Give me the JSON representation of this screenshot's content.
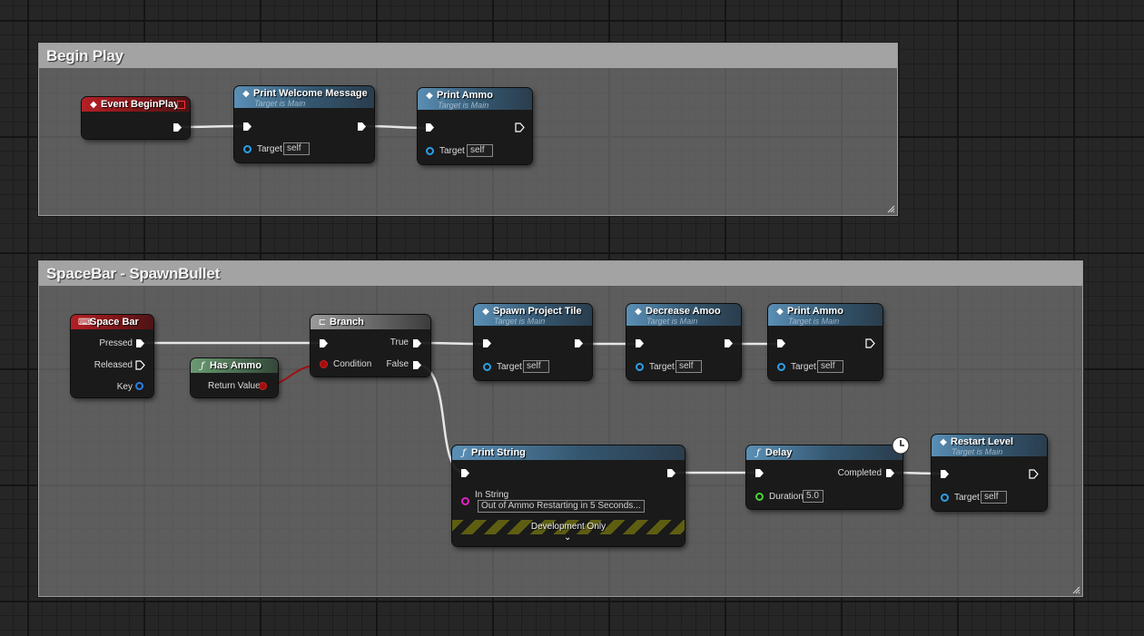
{
  "comments": {
    "begin_play": "Begin Play",
    "spacebar": "SpaceBar - SpawnBullet"
  },
  "nodes": {
    "event_begin_play": {
      "title": "Event BeginPlay"
    },
    "print_welcome": {
      "title": "Print Welcome Message",
      "subtitle": "Target is Main",
      "target_label": "Target",
      "target_value": "self"
    },
    "print_ammo_1": {
      "title": "Print Ammo",
      "subtitle": "Target is Main",
      "target_label": "Target",
      "target_value": "self"
    },
    "space_bar": {
      "title": "Space Bar",
      "pressed": "Pressed",
      "released": "Released",
      "key": "Key"
    },
    "has_ammo": {
      "title": "Has Ammo",
      "return_value": "Return Value"
    },
    "branch": {
      "title": "Branch",
      "condition": "Condition",
      "true_label": "True",
      "false_label": "False"
    },
    "spawn_projectile": {
      "title": "Spawn Project Tile",
      "subtitle": "Target is Main",
      "target_label": "Target",
      "target_value": "self"
    },
    "decrease_ammo": {
      "title": "Decrease Amoo",
      "subtitle": "Target is Main",
      "target_label": "Target",
      "target_value": "self"
    },
    "print_ammo_2": {
      "title": "Print Ammo",
      "subtitle": "Target is Main",
      "target_label": "Target",
      "target_value": "self"
    },
    "print_string": {
      "title": "Print String",
      "in_string_label": "In String",
      "in_string_value": "Out of Ammo Restarting in 5 Seconds...",
      "dev_only": "Development Only"
    },
    "delay": {
      "title": "Delay",
      "completed": "Completed",
      "duration_label": "Duration",
      "duration_value": "5.0"
    },
    "restart_level": {
      "title": "Restart Level",
      "subtitle": "Target is Main",
      "target_label": "Target",
      "target_value": "self"
    }
  },
  "icons": {
    "event": "event-diamond-icon",
    "function": "function-f-icon",
    "keyboard": "keyboard-icon",
    "branch": "branch-icon",
    "latent": "clock-icon"
  },
  "colors": {
    "exec_wire": "#e6e6e6",
    "bool_pin": "#a10f0f",
    "object_pin": "#2aa0e8",
    "string_pin": "#e020c0",
    "float_pin": "#4ad43a"
  }
}
